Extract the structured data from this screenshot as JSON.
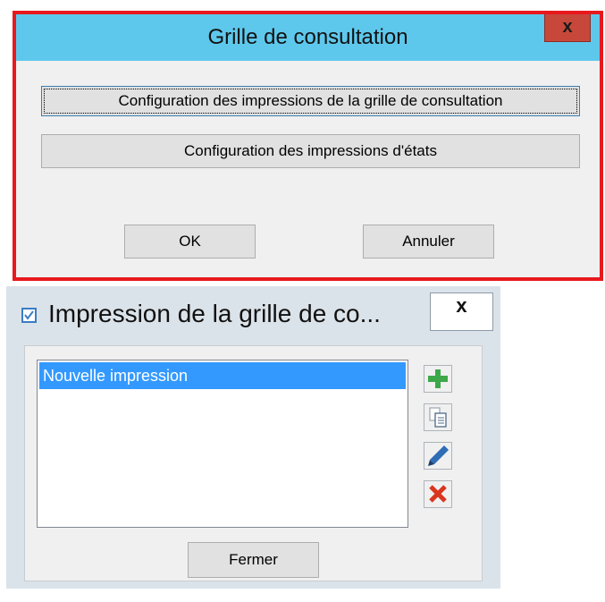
{
  "dialog_consultation": {
    "title": "Grille de consultation",
    "close_label": "x",
    "button_grid_print": "Configuration des impressions de la grille de consultation",
    "button_reports_print": "Configuration des impressions d'états",
    "ok_label": "OK",
    "cancel_label": "Annuler",
    "highlight_color": "#e8181d",
    "title_bar_color": "#5ec8ec"
  },
  "dialog_print": {
    "title": "Impression de la grille de co...",
    "close_label": "x",
    "list_items": [
      {
        "label": "Nouvelle impression",
        "selected": true
      }
    ],
    "toolbar_icons": [
      "add-icon",
      "copy-icon",
      "edit-icon",
      "delete-icon"
    ],
    "close_button_label": "Fermer",
    "selection_color": "#3399ff"
  }
}
